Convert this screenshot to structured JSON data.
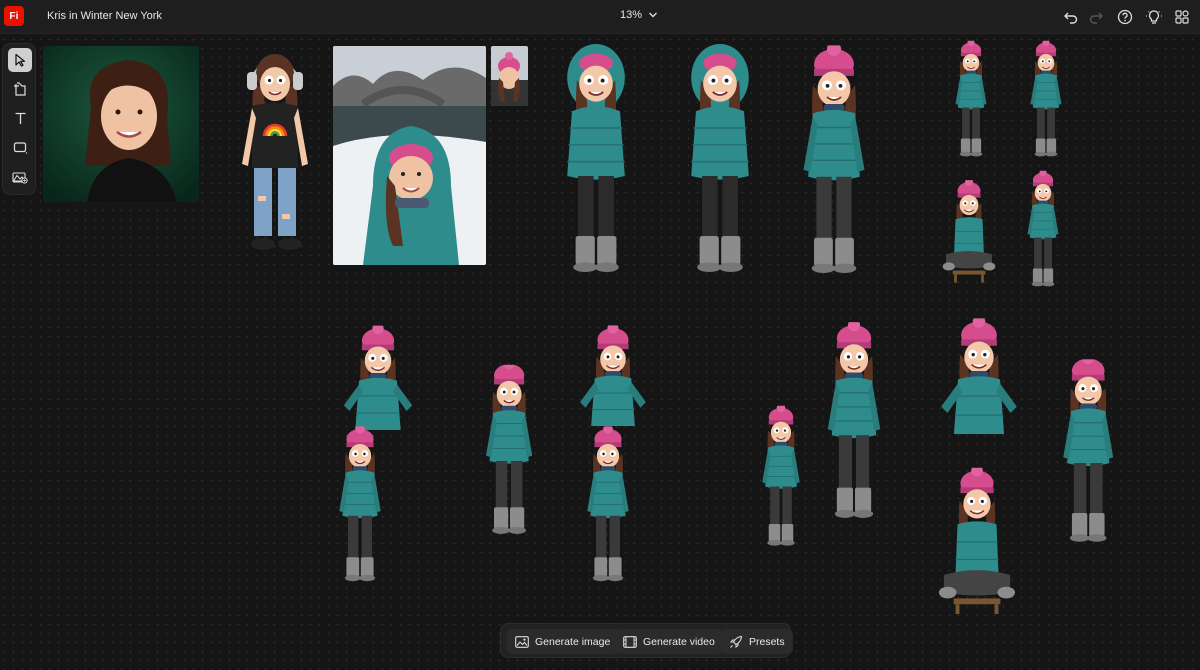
{
  "app": {
    "logo_text": "Fi",
    "doc_title": "Kris in Winter New York",
    "zoom_level": "13%"
  },
  "header_icons": [
    "undo-icon",
    "redo-icon",
    "help-icon",
    "lightbulb-icon",
    "apps-icon"
  ],
  "tools": [
    "select-tool-icon",
    "artboard-tool-icon",
    "text-tool-icon",
    "shape-tool-icon",
    "image-tool-icon"
  ],
  "bottom_bar": {
    "generate_image": "Generate image",
    "generate_video": "Generate video",
    "presets": "Presets"
  },
  "colors": {
    "accent": "#eb1000",
    "jacket": "#2f8c8c",
    "hat": "#d64d8e",
    "hair": "#5a3322",
    "skin": "#f3c8a8",
    "pants": "#3a3a3a",
    "boots": "#8c8c8c",
    "studio_bg": "#0e3a2a"
  }
}
